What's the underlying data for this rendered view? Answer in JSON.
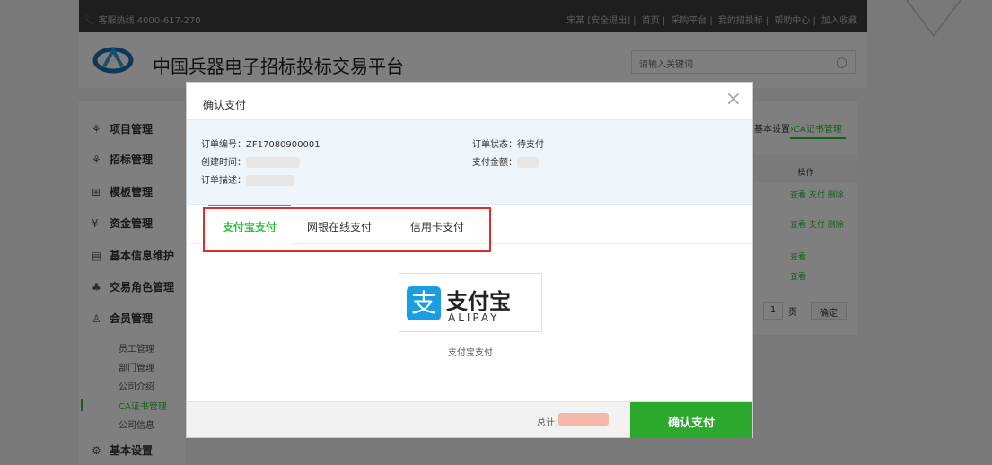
{
  "topbar": {
    "hotline": "📞 客服热线 4000-617-270",
    "links": [
      "宋某 [安全退出]",
      "首页",
      "采购平台",
      "我的招投标",
      "帮助中心",
      "加入收藏"
    ]
  },
  "header": {
    "site_title": "中国兵器电子招标投标交易平台",
    "search_placeholder": "请输入关键词"
  },
  "sidebar": {
    "items": [
      {
        "icon": "⚘",
        "label": "项目管理"
      },
      {
        "icon": "⚘",
        "label": "招标管理"
      },
      {
        "icon": "⊞",
        "label": "模板管理"
      },
      {
        "icon": "¥",
        "label": "资金管理"
      },
      {
        "icon": "▤",
        "label": "基本信息维护"
      },
      {
        "icon": "♣",
        "label": "交易角色管理"
      },
      {
        "icon": "♙",
        "label": "会员管理"
      }
    ],
    "sub_items": [
      "员工管理",
      "部门管理",
      "公司介绍",
      "CA证书管理",
      "公司信息"
    ],
    "bottom_item": {
      "icon": "⚙",
      "label": "基本设置"
    }
  },
  "right_panel": {
    "breadcrumb_a": "基本设置",
    "breadcrumb_sep": "›",
    "breadcrumb_b": "CA证书管理",
    "ops_header": "操作",
    "row_ops": [
      "查看 支付 删除",
      "查看 支付 删除",
      "查看",
      "查看"
    ],
    "page_num": "1",
    "page_unit": "页",
    "confirm": "确定"
  },
  "modal": {
    "title": "确认支付",
    "close_glyph": "×",
    "order_no_label": "订单编号：ZF17080900001",
    "create_time_label": "创建时间：",
    "desc_label": "订单描述：",
    "status_label": "订单状态：待支付",
    "amount_label": "支付金额：",
    "tabs": [
      "支付宝支付",
      "网银在线支付",
      "信用卡支付"
    ],
    "alipay_icon": "支",
    "alipay_cn": "支付宝",
    "alipay_en": "ALIPAY",
    "alipay_caption": "支付宝支付",
    "total_label": "总计：",
    "pay_button": "确认支付"
  },
  "colors": {
    "accent": "#2cbf3a",
    "alipay": "#1b9de2",
    "highlight": "#e02b2b"
  }
}
